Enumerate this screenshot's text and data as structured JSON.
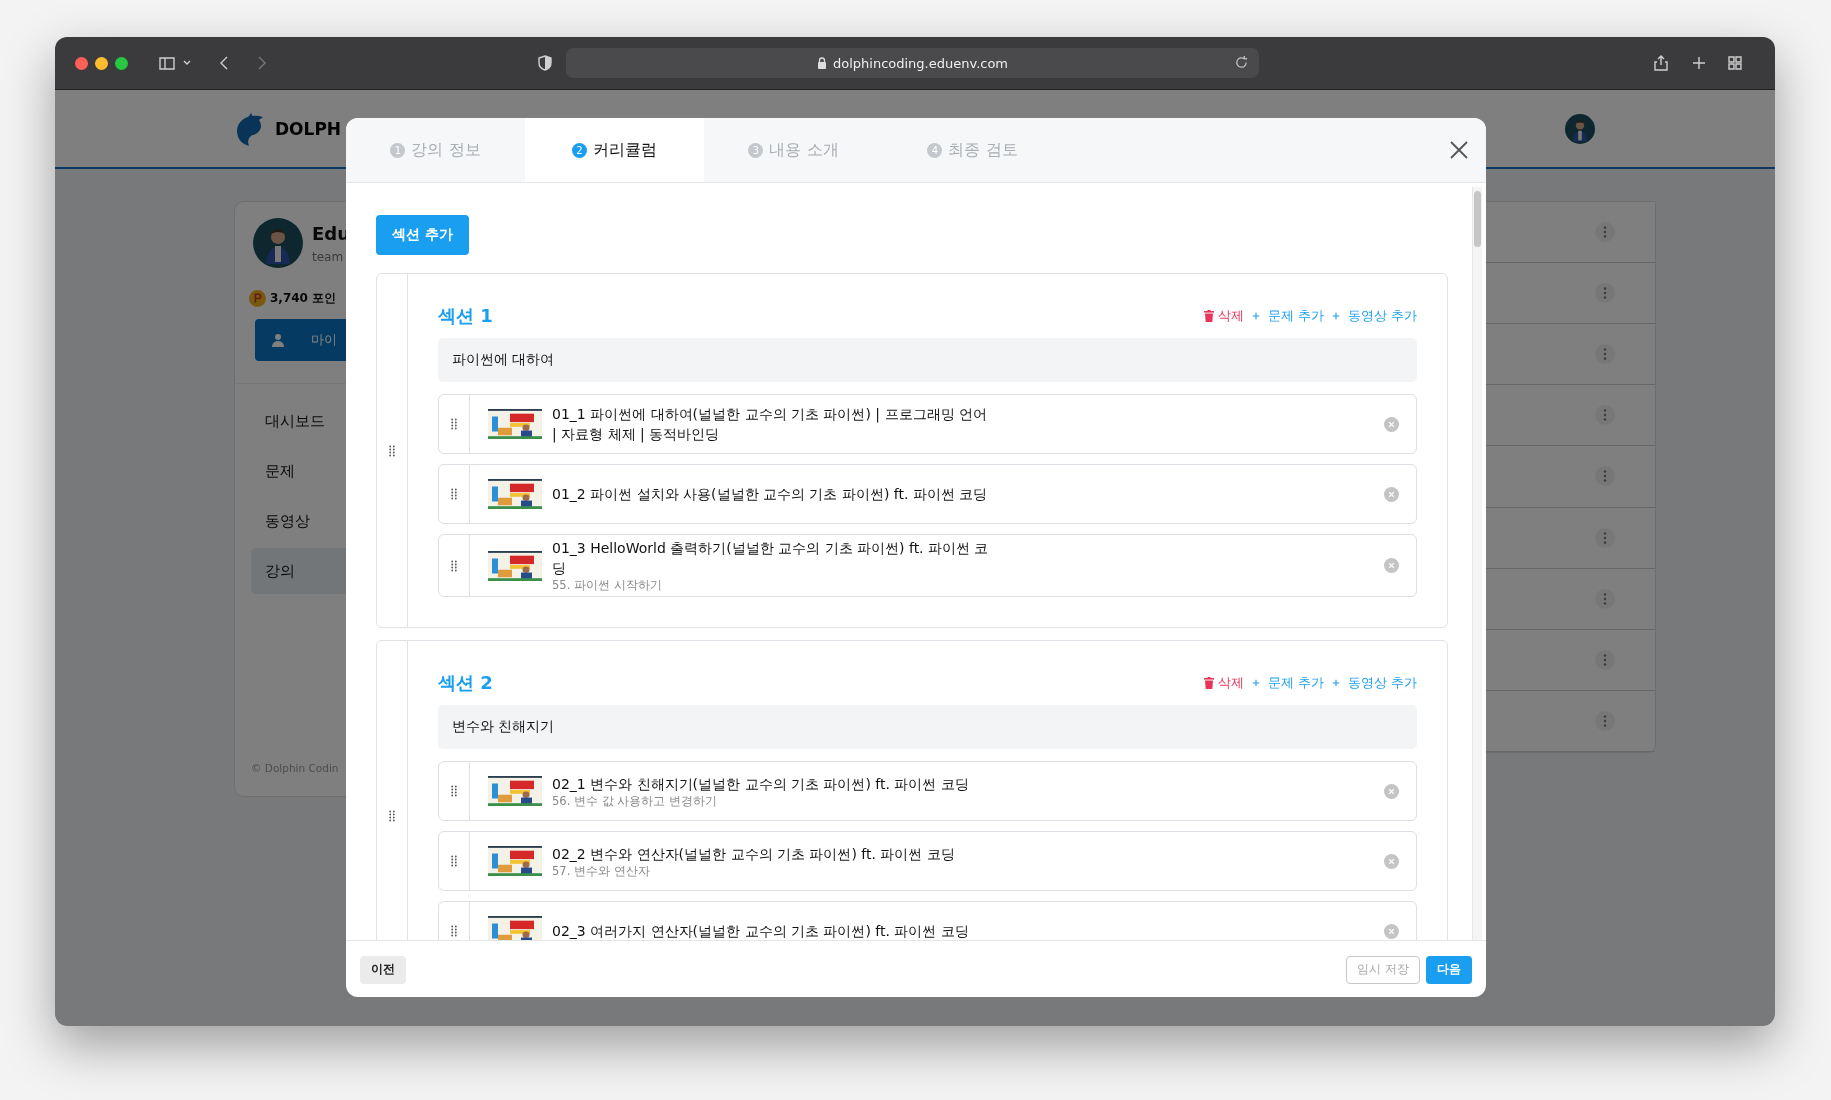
{
  "browser": {
    "url": "dolphincoding.eduenv.com"
  },
  "site": {
    "logo_text": "DOLPH",
    "profile": {
      "name": "Edu",
      "email": "team",
      "points": "3,740 포인",
      "my_button": "마이"
    },
    "nav": [
      {
        "label": "대시보드",
        "selected": false
      },
      {
        "label": "문제",
        "selected": false
      },
      {
        "label": "동영상",
        "selected": false
      },
      {
        "label": "강의",
        "selected": true
      }
    ],
    "footer": "© Dolphin Codin"
  },
  "modal": {
    "tabs": [
      {
        "number": "1",
        "label": "강의 정보",
        "selected": false
      },
      {
        "number": "2",
        "label": "커리큘럼",
        "selected": true
      },
      {
        "number": "3",
        "label": "내용 소개",
        "selected": false
      },
      {
        "number": "4",
        "label": "최종 검토",
        "selected": false
      }
    ],
    "add_section_button": "섹션 추가",
    "sections": [
      {
        "title": "섹션 1",
        "delete": "삭제",
        "add_problem": "문제 추가",
        "add_video": "동영상 추가",
        "name": "파이썬에 대하여",
        "items": [
          {
            "title": "01_1 파이썬에 대하여(널널한 교수의 기초 파이썬) | 프로그래밍 언어 | 자료형 체제 | 동적바인딩"
          },
          {
            "title": "01_2 파이썬 설치와 사용(널널한 교수의 기초 파이썬) ft. 파이썬 코딩"
          },
          {
            "title": "01_3 HelloWorld 출력하기(널널한 교수의 기초 파이썬) ft. 파이썬 코딩",
            "subtitle": "55. 파이썬 시작하기"
          }
        ]
      },
      {
        "title": "섹션 2",
        "delete": "삭제",
        "add_problem": "문제 추가",
        "add_video": "동영상 추가",
        "name": "변수와 친해지기",
        "items": [
          {
            "title": "02_1 변수와 친해지기(널널한 교수의 기초 파이썬) ft. 파이썬 코딩",
            "subtitle": "56. 변수 값 사용하고 변경하기"
          },
          {
            "title": "02_2 변수와 연산자(널널한 교수의 기초 파이썬) ft. 파이썬 코딩",
            "subtitle": "57. 변수와 연산자"
          },
          {
            "title": "02_3 여러가지 연산자(널널한 교수의 기초 파이썬) ft. 파이썬 코딩"
          }
        ]
      }
    ],
    "footer": {
      "prev": "이전",
      "save_draft": {
        "label": "임시 저장",
        "disabled": true
      },
      "next": "다음"
    }
  }
}
